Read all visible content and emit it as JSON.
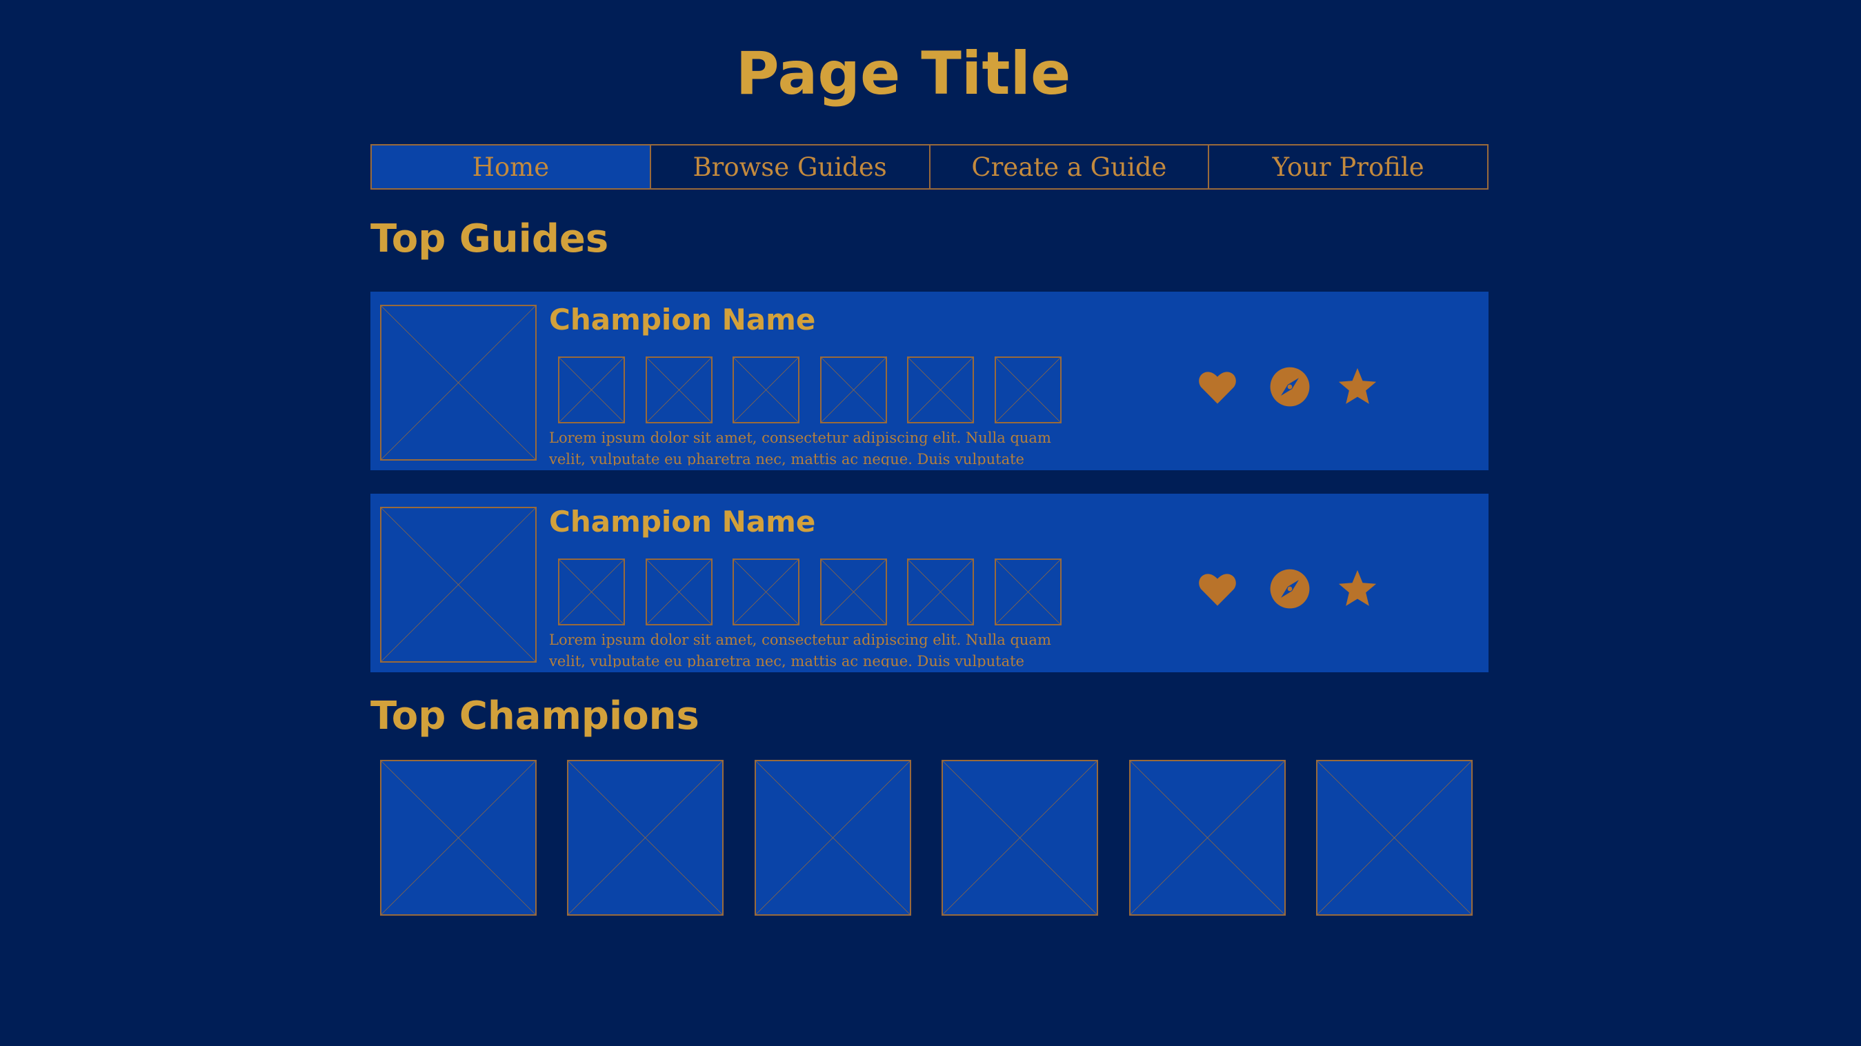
{
  "page": {
    "title": "Page Title"
  },
  "nav": {
    "items": [
      {
        "label": "Home",
        "active": true
      },
      {
        "label": "Browse Guides",
        "active": false
      },
      {
        "label": "Create a Guide",
        "active": false
      },
      {
        "label": "Your Profile",
        "active": false
      }
    ]
  },
  "top_guides": {
    "heading": "Top Guides",
    "guides": [
      {
        "champion_name": "Champion Name",
        "item_count": 6,
        "description": "Lorem ipsum dolor sit amet, consectetur adipiscing elit. Nulla quam velit, vulputate eu pharetra nec, mattis ac neque. Duis vulputate commodo lectus.",
        "actions": [
          "heart-icon",
          "compass-icon",
          "star-icon"
        ]
      },
      {
        "champion_name": "Champion Name",
        "item_count": 6,
        "description": "Lorem ipsum dolor sit amet, consectetur adipiscing elit. Nulla quam velit, vulputate eu pharetra nec, mattis ac neque. Duis vulputate commodo lectus.",
        "actions": [
          "heart-icon",
          "compass-icon",
          "star-icon"
        ]
      }
    ]
  },
  "top_champions": {
    "heading": "Top Champions",
    "count": 6
  },
  "colors": {
    "background": "#001e56",
    "card": "#0a44a8",
    "accent_gold": "#d3a13b",
    "accent_bronze": "#b9732a",
    "placeholder_border": "#9a6a3a"
  }
}
